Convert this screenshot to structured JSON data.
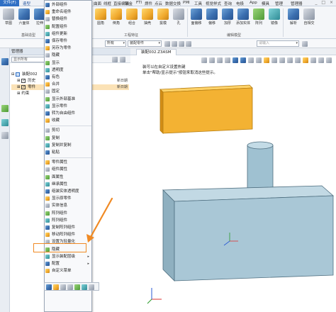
{
  "ribbon": {
    "file_tab": "文件(F)",
    "tabs": [
      "造型",
      "曲面",
      "线框",
      "直接编辑",
      "钣金",
      "FTI",
      "焊件",
      "点云",
      "数据交换",
      "PMI",
      "工具",
      "视觉样式",
      "查询",
      "电极",
      "App",
      "模具",
      "管理",
      "管理器"
    ],
    "buttons": [
      "草图",
      "六面体",
      "拉伸",
      "旋转",
      "扫掠",
      "放样",
      "圆角",
      "倒角",
      "组合",
      "抽壳",
      "拔模",
      "孔",
      "筋",
      "缝",
      "面偏移",
      "偏移",
      "加厚",
      "添加实体",
      "阵列",
      "镜像",
      "解析",
      "自相交"
    ],
    "groups": [
      "基础造型",
      "工程特征",
      "编辑模型"
    ],
    "window_controls": "_ □ ×"
  },
  "selection_bar": {
    "filter_value": "所有",
    "pick_value": "装配零件",
    "search_placeholder": "请输入"
  },
  "manager": {
    "title": "管理器",
    "filter_text": "显示所有",
    "tree": [
      {
        "label": "装配002",
        "date": "",
        "checked": false,
        "selected": false
      },
      {
        "label": "历史",
        "date": "新日期",
        "checked": true,
        "selected": false
      },
      {
        "label": "零件",
        "date": "新日期",
        "checked": true,
        "selected": true
      },
      {
        "label": "约束",
        "date": "",
        "checked": false,
        "selected": false
      }
    ]
  },
  "viewport": {
    "doc_tab": "装配002.Z3ASM",
    "hint_line1": "装可以在自定义设置热键",
    "hint_line2": "单击\"帮助/显示提示\"按钮来取消这些提示。"
  },
  "context_menu": {
    "items": [
      {
        "label": "外部组件",
        "arrow": false,
        "disabled": false
      },
      {
        "label": "重命名组件",
        "arrow": false,
        "disabled": false
      },
      {
        "label": "替换组件",
        "arrow": false,
        "disabled": false
      },
      {
        "label": "配置组件",
        "arrow": false,
        "disabled": false
      },
      {
        "label": "组件更新",
        "arrow": false,
        "disabled": false
      },
      {
        "label": "保存零件",
        "arrow": false,
        "disabled": false
      },
      {
        "label": "另存为零件",
        "arrow": false,
        "disabled": false
      },
      {
        "label": "隐藏",
        "arrow": false,
        "disabled": false
      },
      {
        "label": "显示",
        "arrow": false,
        "disabled": false
      },
      {
        "label": "透明度",
        "arrow": false,
        "disabled": false
      },
      {
        "label": "有色",
        "arrow": false,
        "disabled": false
      },
      {
        "label": "合并",
        "arrow": false,
        "disabled": false
      },
      {
        "label": "固定",
        "arrow": false,
        "disabled": false
      },
      {
        "label": "显示外部基准",
        "arrow": false,
        "disabled": false
      },
      {
        "label": "显示零件",
        "arrow": false,
        "disabled": false
      },
      {
        "label": "转为自由组件",
        "arrow": false,
        "disabled": false
      },
      {
        "label": "收藏",
        "arrow": false,
        "disabled": false
      },
      {
        "label": "剪切",
        "arrow": false,
        "disabled": false
      },
      {
        "label": "复制",
        "arrow": false,
        "disabled": false
      },
      {
        "label": "复制并复制",
        "arrow": false,
        "disabled": false
      },
      {
        "label": "粘贴",
        "arrow": false,
        "disabled": false
      },
      {
        "label": "零件属性",
        "arrow": false,
        "disabled": false
      },
      {
        "label": "组件属性",
        "arrow": false,
        "disabled": false
      },
      {
        "label": "面属性",
        "arrow": false,
        "disabled": false
      },
      {
        "label": "继承属性",
        "arrow": false,
        "disabled": false
      },
      {
        "label": "组装实体透明度",
        "arrow": false,
        "disabled": false
      },
      {
        "label": "显示原零件",
        "arrow": false,
        "disabled": false
      },
      {
        "label": "实体信息",
        "arrow": false,
        "disabled": false
      },
      {
        "label": "阵列组件",
        "arrow": false,
        "disabled": false
      },
      {
        "label": "阵列组件",
        "arrow": false,
        "disabled": false
      },
      {
        "label": "复制阵列组件",
        "arrow": false,
        "disabled": false
      },
      {
        "label": "移动阵列组件",
        "arrow": false,
        "disabled": false
      },
      {
        "label": "设置为轻量化",
        "arrow": false,
        "disabled": false
      },
      {
        "label": "隐藏",
        "arrow": false,
        "disabled": false
      },
      {
        "label": "显示装配层级",
        "arrow": true,
        "disabled": false
      },
      {
        "label": "配置",
        "arrow": true,
        "disabled": false
      },
      {
        "label": "自定义菜单",
        "arrow": false,
        "disabled": false
      }
    ],
    "highlighted_item": "设置为轻量化"
  },
  "colors": {
    "accent": "#2f6fc4",
    "yellow_part": "#f3b233",
    "blue_part": "#a9c7d6",
    "annotation_arrow": "#f08a24"
  },
  "icons": [
    "cube-icon",
    "extrude-icon",
    "fillet-icon",
    "shell-icon",
    "filter-icon",
    "gear-icon",
    "triad-icon"
  ]
}
